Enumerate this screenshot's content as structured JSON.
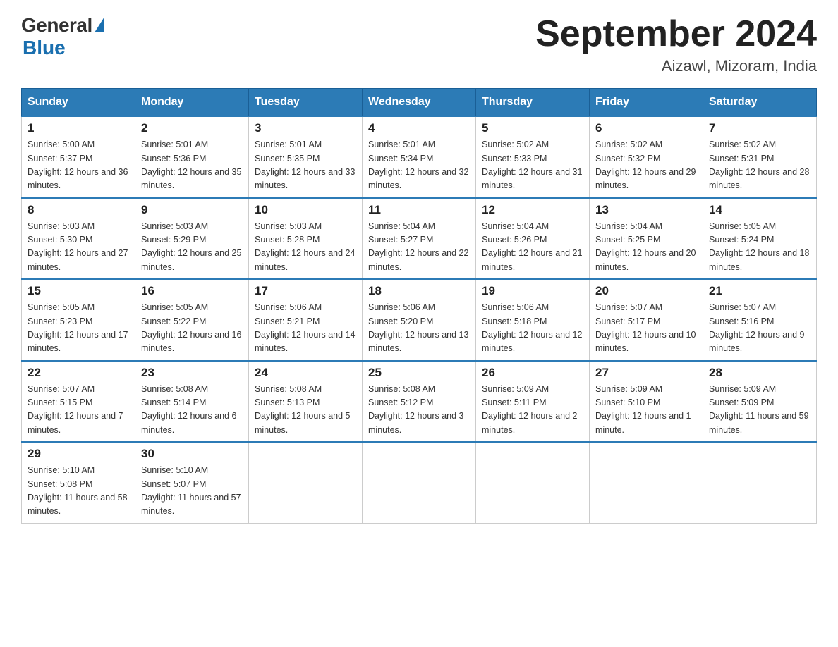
{
  "header": {
    "logo_general": "General",
    "logo_blue": "Blue",
    "month_title": "September 2024",
    "location": "Aizawl, Mizoram, India"
  },
  "days_of_week": [
    "Sunday",
    "Monday",
    "Tuesday",
    "Wednesday",
    "Thursday",
    "Friday",
    "Saturday"
  ],
  "weeks": [
    [
      {
        "day": "1",
        "sunrise": "5:00 AM",
        "sunset": "5:37 PM",
        "daylight": "12 hours and 36 minutes."
      },
      {
        "day": "2",
        "sunrise": "5:01 AM",
        "sunset": "5:36 PM",
        "daylight": "12 hours and 35 minutes."
      },
      {
        "day": "3",
        "sunrise": "5:01 AM",
        "sunset": "5:35 PM",
        "daylight": "12 hours and 33 minutes."
      },
      {
        "day": "4",
        "sunrise": "5:01 AM",
        "sunset": "5:34 PM",
        "daylight": "12 hours and 32 minutes."
      },
      {
        "day": "5",
        "sunrise": "5:02 AM",
        "sunset": "5:33 PM",
        "daylight": "12 hours and 31 minutes."
      },
      {
        "day": "6",
        "sunrise": "5:02 AM",
        "sunset": "5:32 PM",
        "daylight": "12 hours and 29 minutes."
      },
      {
        "day": "7",
        "sunrise": "5:02 AM",
        "sunset": "5:31 PM",
        "daylight": "12 hours and 28 minutes."
      }
    ],
    [
      {
        "day": "8",
        "sunrise": "5:03 AM",
        "sunset": "5:30 PM",
        "daylight": "12 hours and 27 minutes."
      },
      {
        "day": "9",
        "sunrise": "5:03 AM",
        "sunset": "5:29 PM",
        "daylight": "12 hours and 25 minutes."
      },
      {
        "day": "10",
        "sunrise": "5:03 AM",
        "sunset": "5:28 PM",
        "daylight": "12 hours and 24 minutes."
      },
      {
        "day": "11",
        "sunrise": "5:04 AM",
        "sunset": "5:27 PM",
        "daylight": "12 hours and 22 minutes."
      },
      {
        "day": "12",
        "sunrise": "5:04 AM",
        "sunset": "5:26 PM",
        "daylight": "12 hours and 21 minutes."
      },
      {
        "day": "13",
        "sunrise": "5:04 AM",
        "sunset": "5:25 PM",
        "daylight": "12 hours and 20 minutes."
      },
      {
        "day": "14",
        "sunrise": "5:05 AM",
        "sunset": "5:24 PM",
        "daylight": "12 hours and 18 minutes."
      }
    ],
    [
      {
        "day": "15",
        "sunrise": "5:05 AM",
        "sunset": "5:23 PM",
        "daylight": "12 hours and 17 minutes."
      },
      {
        "day": "16",
        "sunrise": "5:05 AM",
        "sunset": "5:22 PM",
        "daylight": "12 hours and 16 minutes."
      },
      {
        "day": "17",
        "sunrise": "5:06 AM",
        "sunset": "5:21 PM",
        "daylight": "12 hours and 14 minutes."
      },
      {
        "day": "18",
        "sunrise": "5:06 AM",
        "sunset": "5:20 PM",
        "daylight": "12 hours and 13 minutes."
      },
      {
        "day": "19",
        "sunrise": "5:06 AM",
        "sunset": "5:18 PM",
        "daylight": "12 hours and 12 minutes."
      },
      {
        "day": "20",
        "sunrise": "5:07 AM",
        "sunset": "5:17 PM",
        "daylight": "12 hours and 10 minutes."
      },
      {
        "day": "21",
        "sunrise": "5:07 AM",
        "sunset": "5:16 PM",
        "daylight": "12 hours and 9 minutes."
      }
    ],
    [
      {
        "day": "22",
        "sunrise": "5:07 AM",
        "sunset": "5:15 PM",
        "daylight": "12 hours and 7 minutes."
      },
      {
        "day": "23",
        "sunrise": "5:08 AM",
        "sunset": "5:14 PM",
        "daylight": "12 hours and 6 minutes."
      },
      {
        "day": "24",
        "sunrise": "5:08 AM",
        "sunset": "5:13 PM",
        "daylight": "12 hours and 5 minutes."
      },
      {
        "day": "25",
        "sunrise": "5:08 AM",
        "sunset": "5:12 PM",
        "daylight": "12 hours and 3 minutes."
      },
      {
        "day": "26",
        "sunrise": "5:09 AM",
        "sunset": "5:11 PM",
        "daylight": "12 hours and 2 minutes."
      },
      {
        "day": "27",
        "sunrise": "5:09 AM",
        "sunset": "5:10 PM",
        "daylight": "12 hours and 1 minute."
      },
      {
        "day": "28",
        "sunrise": "5:09 AM",
        "sunset": "5:09 PM",
        "daylight": "11 hours and 59 minutes."
      }
    ],
    [
      {
        "day": "29",
        "sunrise": "5:10 AM",
        "sunset": "5:08 PM",
        "daylight": "11 hours and 58 minutes."
      },
      {
        "day": "30",
        "sunrise": "5:10 AM",
        "sunset": "5:07 PM",
        "daylight": "11 hours and 57 minutes."
      },
      null,
      null,
      null,
      null,
      null
    ]
  ]
}
